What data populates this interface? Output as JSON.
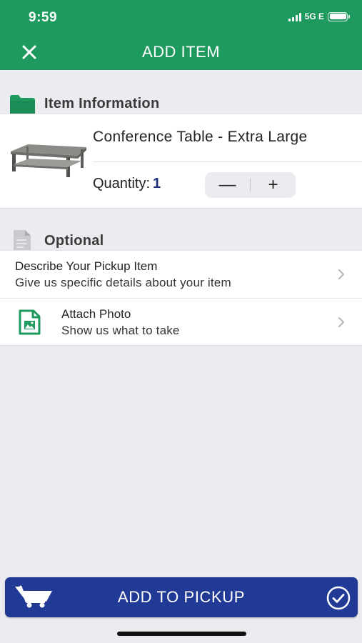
{
  "status_bar": {
    "time": "9:59",
    "network": "5G E"
  },
  "header": {
    "title": "ADD ITEM",
    "close_label": "X",
    "color": "#1f9a5f"
  },
  "item_section": {
    "title": "Item Information",
    "icon": "folder-icon"
  },
  "item": {
    "name": "Conference Table - Extra Large",
    "image": "conference-table-image",
    "quantity_label": "Quantity:",
    "quantity": "1",
    "decrement_label": "—",
    "increment_label": "+"
  },
  "optional_section": {
    "title": "Optional",
    "icon": "document-icon"
  },
  "options": [
    {
      "title": "Describe Your Pickup Item",
      "subtitle": "Give us specific details about your item",
      "icon": "chevron-right-icon"
    },
    {
      "title": "Attach Photo",
      "subtitle": "Show us what to take",
      "icon": "photo-document-icon"
    }
  ],
  "footer": {
    "button_label": "ADD TO PICKUP",
    "color": "#213a96",
    "icons": [
      "cart-icon",
      "check-circle-icon"
    ]
  }
}
